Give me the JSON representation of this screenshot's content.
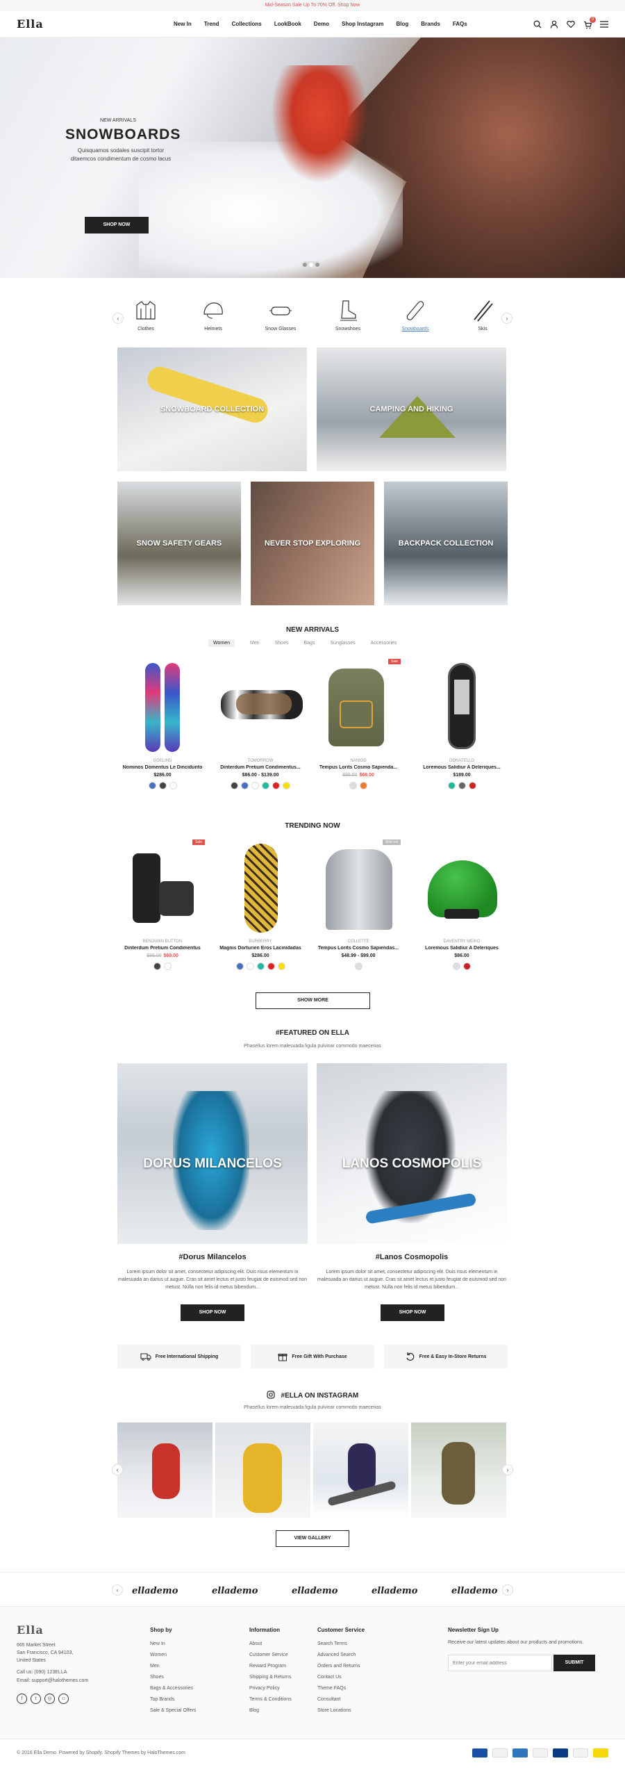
{
  "topbar": {
    "promo": "Mid-Season Sale Up To 70% Off. Shop Now"
  },
  "header": {
    "logo": "Ella",
    "nav": [
      "New In",
      "Trend",
      "Collections",
      "LookBook",
      "Demo",
      "Shop Instagram",
      "Blog",
      "Brands",
      "FAQs"
    ],
    "cart_count": "0",
    "icons": [
      "search-icon",
      "user-icon",
      "heart-icon",
      "cart-icon",
      "menu-icon"
    ]
  },
  "hero": {
    "subtitle": "NEW ARRIVALS",
    "title": "SNOWBOARDS",
    "description": "Quisquamos sodales suscipit tortor ditaemcos condimentum de cosmo lacus",
    "button": "SHOP NOW"
  },
  "categories": [
    {
      "label": "Clothes",
      "icon": "jacket-icon"
    },
    {
      "label": "Helmets",
      "icon": "helmet-icon"
    },
    {
      "label": "Snow Glasses",
      "icon": "goggles-icon"
    },
    {
      "label": "Snowshoes",
      "icon": "boot-icon"
    },
    {
      "label": "Snowboards",
      "icon": "snowboard-icon",
      "active": true
    },
    {
      "label": "Skis",
      "icon": "skis-icon"
    }
  ],
  "collections": [
    {
      "label": "SNOWBOARD COLLECTION"
    },
    {
      "label": "CAMPING AND HIKING"
    },
    {
      "label": "SNOW SAFETY GEARS"
    },
    {
      "label": "NEVER STOP EXPLORING"
    },
    {
      "label": "BACKPACK COLLECTION"
    }
  ],
  "new_arrivals": {
    "title": "NEW ARRIVALS",
    "tabs": [
      "Women",
      "Men",
      "Shoes",
      "Bags",
      "Sunglasses",
      "Accessories"
    ],
    "products": [
      {
        "brand": "GOELIND",
        "name": "Nominos Domentus Le Dincidunto",
        "price": "$286.00",
        "old_price": "",
        "badge": "",
        "colors": [
          "#4a6fc1",
          "#444444",
          "#ffffff"
        ]
      },
      {
        "brand": "TOMORROW",
        "name": "Dinterdum Pretium Condimentus...",
        "price": "$86.00 - $139.00",
        "old_price": "",
        "badge": "",
        "colors": [
          "#444444",
          "#4a6fc1",
          "#ffffff",
          "#22b8a0",
          "#dd2222",
          "#f5e000"
        ]
      },
      {
        "brand": "NANIOD",
        "name": "Tempus Lorits Cosmo Sapienda...",
        "price": "$69.00",
        "old_price": "$86.00",
        "badge": "Sale",
        "colors": [
          "#dddddd",
          "#f07a2a"
        ]
      },
      {
        "brand": "DONATELLO",
        "name": "Loremous Salidiur A Deleriques...",
        "price": "$189.00",
        "old_price": "",
        "badge": "",
        "colors": [
          "#22b8a0",
          "#666666",
          "#cc2222"
        ]
      }
    ]
  },
  "trending": {
    "title": "TRENDING NOW",
    "products": [
      {
        "brand": "BENJAMIN BUTTON",
        "name": "Dinterdum Pretium Condimentus",
        "price": "$69.00",
        "old_price": "$86.00",
        "badge": "Sale",
        "colors": [
          "#444444",
          "#ffffff"
        ]
      },
      {
        "brand": "BURBERRY",
        "name": "Magnis Dorturien Eros Lacinidadas",
        "price": "$286.00",
        "old_price": "",
        "badge": "",
        "colors": [
          "#4a6fc1",
          "#ffffff",
          "#22b8a0",
          "#dd2222",
          "#f5e000"
        ]
      },
      {
        "brand": "COLLETTE",
        "name": "Tempus Lorits Cosmo Sapiendas...",
        "price": "$48.99 - $99.00",
        "old_price": "",
        "badge": "Sold out",
        "colors": [
          "#dddddd"
        ]
      },
      {
        "brand": "DAVENTRY MEIKO",
        "name": "Loremous Salidiur A Deleriques",
        "price": "$86.00",
        "old_price": "",
        "badge": "",
        "colors": [
          "#dddddd",
          "#cc2222"
        ]
      }
    ],
    "show_more": "SHOW MORE"
  },
  "featured": {
    "title": "#FEATURED ON ELLA",
    "subtitle": "Phasellus lorem malesuada ligula pulvinar commodo maecenas",
    "items": [
      {
        "image_label": "DORUS MILANCELOS",
        "title": "#Dorus Milancelos",
        "text": "Lorem ipsum dolor sit amet, consectetur adipiscing elit. Duis risus elementum in malesuada an darius ut augue. Cras sit amet lectus et justo feugiat de euismod sed non metust. Nulla non felis id metus bibendum...",
        "button": "SHOP NOW"
      },
      {
        "image_label": "LANOS COSMOPOLIS",
        "title": "#Lanos Cosmopolis",
        "text": "Lorem ipsum dolor sit amet, consectetur adipiscing elit. Duis risus elementum in malesuada an darius ut augue. Cras sit amet lectus et justo feugiat de euismod sed non metust. Nulla non felis id metus bibendum...",
        "button": "SHOP NOW"
      }
    ]
  },
  "benefits": [
    {
      "label": "Free International Shipping",
      "icon": "truck-icon"
    },
    {
      "label": "Free Gift With Purchase",
      "icon": "gift-icon"
    },
    {
      "label": "Free & Easy In-Store Returns",
      "icon": "return-icon"
    }
  ],
  "instagram": {
    "title": "#ELLA ON INSTAGRAM",
    "subtitle": "Phasellus lorem malesuada ligula pulvinar commodo maecenas",
    "button": "VIEW GALLERY"
  },
  "brands": [
    "ellademo",
    "ellademo",
    "ellademo",
    "ellademo",
    "ellademo"
  ],
  "footer": {
    "logo": "Ella",
    "address": [
      "665 Market Street",
      "San Francisco, CA 94103,",
      "United States"
    ],
    "call": "Call us: (090) 123ELLA",
    "email": "Email: support@halothemes.com",
    "shop_by": {
      "title": "Shop by",
      "links": [
        "New In",
        "Women",
        "Men",
        "Shoes",
        "Bags & Accessories",
        "Top Brands",
        "Sale & Special Offers"
      ]
    },
    "information": {
      "title": "Information",
      "links": [
        "About",
        "Customer Service",
        "Reward Program",
        "Shipping & Returns",
        "Privacy Policy",
        "Terms & Conditions",
        "Blog"
      ]
    },
    "customer_service": {
      "title": "Customer Service",
      "links": [
        "Search Terms",
        "Advanced Search",
        "Orders and Returns",
        "Contact Us",
        "Theme FAQs",
        "Consultant",
        "Store Locations"
      ]
    },
    "newsletter": {
      "title": "Newsletter Sign Up",
      "text": "Receive our latest updates about our products and promotions.",
      "placeholder": "Enter your email address",
      "button": "SUBMIT"
    },
    "copyright": "© 2016 Ella Demo. Powered by Shopify. Shopify Themes by HaloThemes.com"
  },
  "colors": {
    "accent": "#e0514b",
    "dark": "#222222",
    "link": "#4a7fc1"
  }
}
